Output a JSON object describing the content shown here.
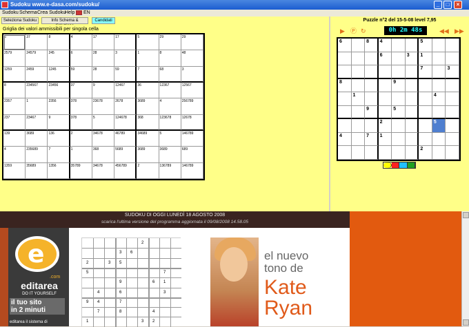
{
  "window": {
    "title": "Sudoku www.e-dasa.com/sudoku/"
  },
  "menu": {
    "items": [
      "Sudoku",
      "Schema",
      "Crea Sudoku",
      "Help"
    ],
    "lang": "EN"
  },
  "toolbar": {
    "buttons": [
      "Seleziona Sudoku",
      "Info Schema & Soluzione",
      "Candidati"
    ]
  },
  "candidates": {
    "caption": "Griglia dei valori ammissibili per singola cella",
    "rows": [
      [
        "6",
        "37",
        "8",
        "4",
        "17",
        "17",
        "5",
        "29",
        "29"
      ],
      [
        "2579",
        "24579",
        "245",
        "6",
        "28",
        "3",
        "1",
        "8",
        "48"
      ],
      [
        "1259",
        "2459",
        "1245",
        "59",
        "28",
        "59",
        "7",
        "68",
        "3"
      ],
      [
        "8",
        "234567",
        "23456",
        "37",
        "9",
        "12467",
        "36",
        "12367",
        "12567"
      ],
      [
        "2357",
        "1",
        "2356",
        "378",
        "23678",
        "2678",
        "3689",
        "4",
        "256789"
      ],
      [
        "237",
        "23467",
        "9",
        "378",
        "5",
        "124678",
        "368",
        "123678",
        "12678"
      ],
      [
        "139",
        "3689",
        "136",
        "2",
        "34678",
        "46789",
        "34689",
        "5",
        "146789"
      ],
      [
        "4",
        "235689",
        "7",
        "1",
        "368",
        "5689",
        "3689",
        "3689",
        "689"
      ],
      [
        "1359",
        "35689",
        "1356",
        "35789",
        "34678",
        "456789",
        "2",
        "136789",
        "146789"
      ]
    ]
  },
  "puzzle": {
    "title": "Puzzle n°2 del 15-5-08 level 7,95",
    "timer": "0h 2m 48s",
    "rows": [
      [
        "6",
        "",
        "8",
        "4",
        "",
        "",
        "5",
        "",
        ""
      ],
      [
        "",
        "",
        "",
        "6",
        "",
        "3",
        "1",
        "",
        ""
      ],
      [
        "",
        "",
        "",
        "",
        "",
        "",
        "7",
        "",
        "3"
      ],
      [
        "8",
        "",
        "",
        "",
        "9",
        "",
        "",
        "",
        ""
      ],
      [
        "",
        "1",
        "",
        "",
        "",
        "",
        "",
        "4",
        ""
      ],
      [
        "",
        "",
        "9",
        "",
        "5",
        "",
        "",
        "",
        ""
      ],
      [
        "",
        "",
        "",
        "2",
        "",
        "",
        "",
        "5",
        ""
      ],
      [
        "4",
        "",
        "7",
        "1",
        "",
        "",
        "",
        "",
        ""
      ],
      [
        "",
        "",
        "",
        "",
        "",
        "",
        "2",
        "",
        ""
      ]
    ],
    "highlight": "6-7",
    "swatches": [
      "#ffff00",
      "#ff2020",
      "#20c0ff",
      "#20a020"
    ]
  },
  "web": {
    "header_title": "SUDOKU DI OGGI LUNEDÌ 18 AGOSTO 2008",
    "header_sub": "scarica l'ultima versione del programma aggiornata il 09/08/2008 14.58.05",
    "ad_left": {
      "brand": "editarea",
      "domain": ".com",
      "slogan": "DO IT YOURSELF",
      "line1": "il tuo sito",
      "line2": "in 2 minuti",
      "footer": "editarea il sistema di"
    },
    "ad_right": {
      "line1": "el nuevo",
      "line2": "tono de",
      "name1": "Kate",
      "name2": "Ryan"
    },
    "mini_sudoku": [
      {
        "r": 0,
        "c": 5,
        "v": "2"
      },
      {
        "r": 1,
        "c": 3,
        "v": "3"
      },
      {
        "r": 1,
        "c": 4,
        "v": "6"
      },
      {
        "r": 2,
        "c": 0,
        "v": "2"
      },
      {
        "r": 2,
        "c": 2,
        "v": "3"
      },
      {
        "r": 2,
        "c": 3,
        "v": "5"
      },
      {
        "r": 3,
        "c": 0,
        "v": "5"
      },
      {
        "r": 3,
        "c": 7,
        "v": "7"
      },
      {
        "r": 4,
        "c": 3,
        "v": "9"
      },
      {
        "r": 4,
        "c": 6,
        "v": "6"
      },
      {
        "r": 4,
        "c": 7,
        "v": "1"
      },
      {
        "r": 5,
        "c": 1,
        "v": "4"
      },
      {
        "r": 5,
        "c": 3,
        "v": "6"
      },
      {
        "r": 5,
        "c": 7,
        "v": "3"
      },
      {
        "r": 6,
        "c": 0,
        "v": "9"
      },
      {
        "r": 6,
        "c": 1,
        "v": "4"
      },
      {
        "r": 6,
        "c": 3,
        "v": "7"
      },
      {
        "r": 7,
        "c": 1,
        "v": "7"
      },
      {
        "r": 7,
        "c": 3,
        "v": "8"
      },
      {
        "r": 7,
        "c": 6,
        "v": "4"
      },
      {
        "r": 8,
        "c": 0,
        "v": "1"
      },
      {
        "r": 8,
        "c": 5,
        "v": "3"
      },
      {
        "r": 8,
        "c": 6,
        "v": "2"
      }
    ]
  }
}
